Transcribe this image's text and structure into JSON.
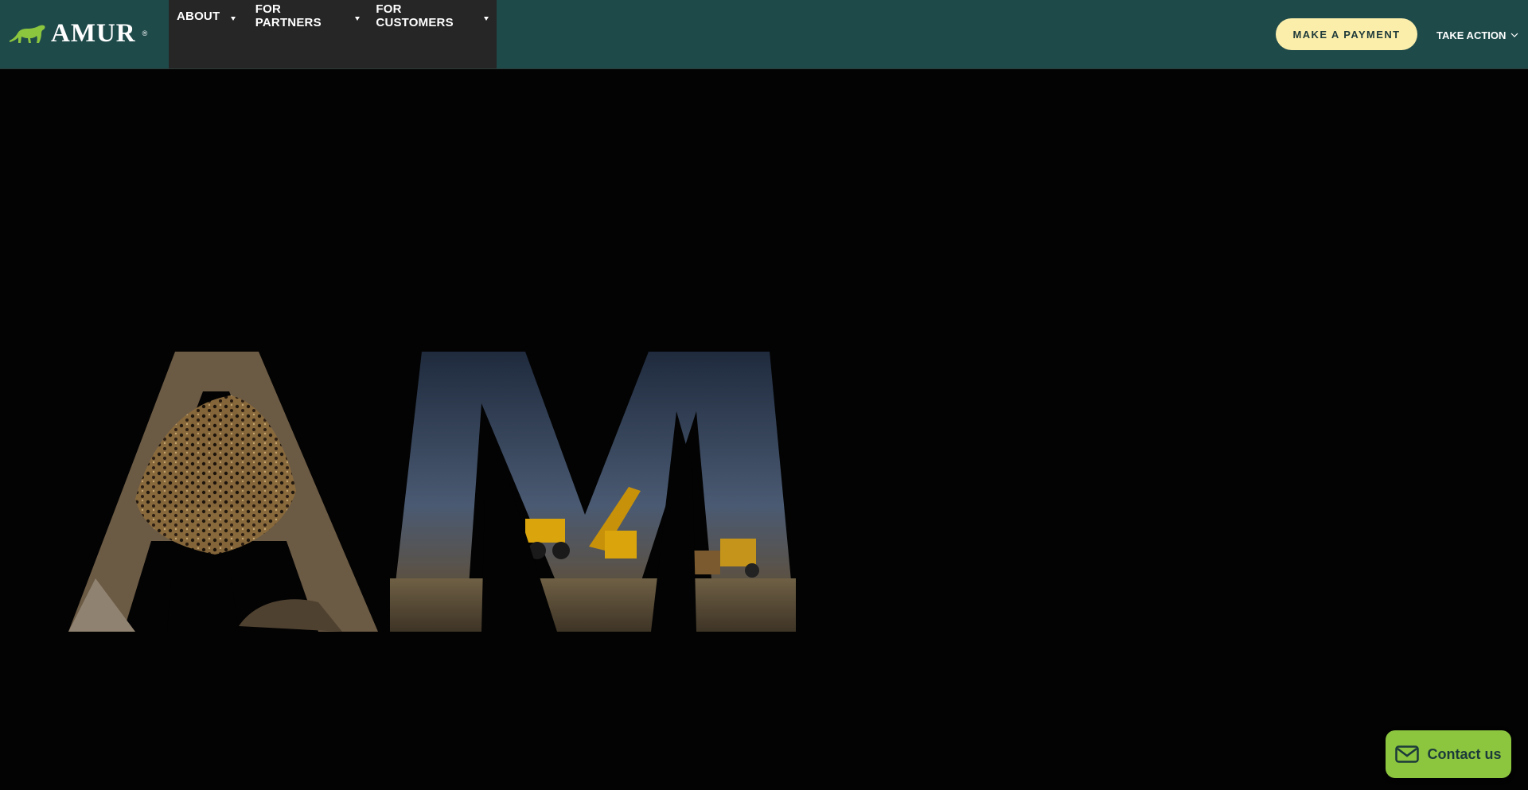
{
  "header": {
    "logo_text": "AMUR",
    "logo_reg": "®",
    "logo_icon": "leopard-icon"
  },
  "nav": {
    "items": [
      {
        "label": "ABOUT"
      },
      {
        "label": "FOR PARTNERS"
      },
      {
        "label": "FOR CUSTOMERS"
      }
    ]
  },
  "actions": {
    "payment_label": "MAKE A PAYMENT",
    "take_action_label": "TAKE ACTION",
    "take_action_icon": "chevron-down-icon"
  },
  "hero": {
    "letters": "AM",
    "letter_fill_a": "leopard photo",
    "letter_fill_m": "construction equipment photo"
  },
  "contact": {
    "label": "Contact us",
    "icon": "envelope-icon"
  },
  "colors": {
    "header_bg": "#1f4a4a",
    "nav_bg": "#262626",
    "payment_bg": "#fbeeaa",
    "contact_bg": "#8cc63f",
    "hero_bg": "#030303"
  }
}
